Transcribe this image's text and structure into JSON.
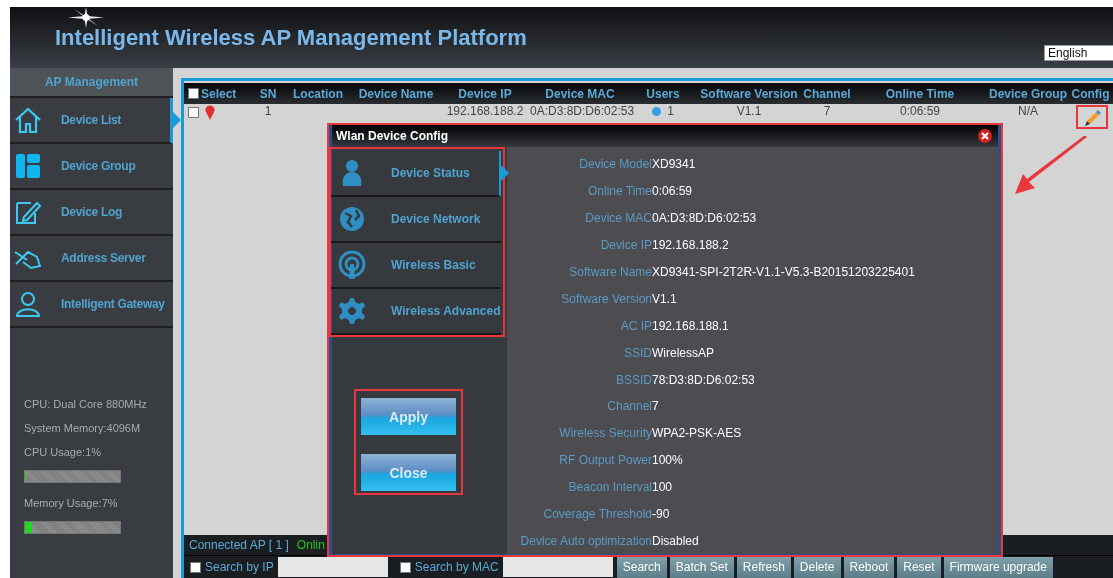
{
  "header": {
    "title": "Intelligent Wireless AP Management Platform",
    "language": "English"
  },
  "sidebar": {
    "heading": "AP Management",
    "items": [
      {
        "label": "Device List",
        "kind": "home",
        "selected": true
      },
      {
        "label": "Device Group",
        "kind": "grid",
        "selected": false
      },
      {
        "label": "Device Log",
        "kind": "edit",
        "selected": false
      },
      {
        "label": "Address Server",
        "kind": "hand",
        "selected": false
      },
      {
        "label": "Intelligent Gateway",
        "kind": "user",
        "selected": false
      }
    ],
    "stats": [
      {
        "kind": "text",
        "text": "CPU: Dual Core 880MHz"
      },
      {
        "kind": "text",
        "text": "System Memory:4096M"
      },
      {
        "kind": "text",
        "text": "CPU Usage:1%"
      },
      {
        "kind": "meter",
        "level": 0.01
      },
      {
        "kind": "text",
        "text": "Memory Usage:7%"
      },
      {
        "kind": "meter",
        "level": 0.07
      }
    ]
  },
  "table": {
    "select_all": {
      "label": "Select",
      "checked": false
    },
    "columns": [
      "SN",
      "Location",
      "Device Name",
      "Device IP",
      "Device MAC",
      "Users",
      "Software Version",
      "Channel",
      "Online Time",
      "Device Group",
      "Config"
    ],
    "rows": [
      {
        "checked": false,
        "sn": "1",
        "device_ip": "192.168.188.2",
        "device_mac": "0A:D3:8D:D6:02:53",
        "users": "1",
        "software_version": "V1.1",
        "channel": "7",
        "online_time": "0:06:59",
        "device_group": "N/A"
      }
    ]
  },
  "status_bar": {
    "connected": "Connected AP [ 1 ]",
    "online": "Onlin"
  },
  "search_bar": {
    "filters": [
      {
        "label": "Search by IP",
        "checked": false
      },
      {
        "label": "Search by MAC",
        "checked": false
      }
    ],
    "buttons": [
      "Search",
      "Batch Set",
      "Refresh",
      "Delete",
      "Reboot",
      "Reset",
      "Firmware upgrade"
    ]
  },
  "dialog": {
    "title": "Wlan Device Config",
    "nav": [
      {
        "label": "Device Status",
        "kind": "user",
        "selected": true
      },
      {
        "label": "Device Network",
        "kind": "globe",
        "selected": false
      },
      {
        "label": "Wireless Basic",
        "kind": "broadcast",
        "selected": false
      },
      {
        "label": "Wireless Advanced",
        "kind": "gear",
        "selected": false
      }
    ],
    "actions": [
      "Apply",
      "Close"
    ],
    "fields": [
      {
        "label": "Device Model",
        "value": "XD9341"
      },
      {
        "label": "Online Time",
        "value": "0:06:59"
      },
      {
        "label": "Device MAC",
        "value": "0A:D3:8D:D6:02:53"
      },
      {
        "label": "Device IP",
        "value": "192.168.188.2"
      },
      {
        "label": "Software Name",
        "value": "XD9341-SPI-2T2R-V1.1-V5.3-B20151203225401"
      },
      {
        "label": "Software Version",
        "value": "V1.1"
      },
      {
        "label": "AC IP",
        "value": "192.168.188.1"
      },
      {
        "label": "SSID",
        "value": "WirelessAP"
      },
      {
        "label": "BSSID",
        "value": "78:D3:8D:D6:02:53"
      },
      {
        "label": "Channel",
        "value": "7"
      },
      {
        "label": "Wireless Security",
        "value": "WPA2-PSK-AES"
      },
      {
        "label": "RF Output Power",
        "value": "100%"
      },
      {
        "label": "Beacon Interval",
        "value": "100"
      },
      {
        "label": "Coverage Threshold",
        "value": "-90"
      },
      {
        "label": "Device Auto optimization",
        "value": "Disabled"
      }
    ]
  }
}
